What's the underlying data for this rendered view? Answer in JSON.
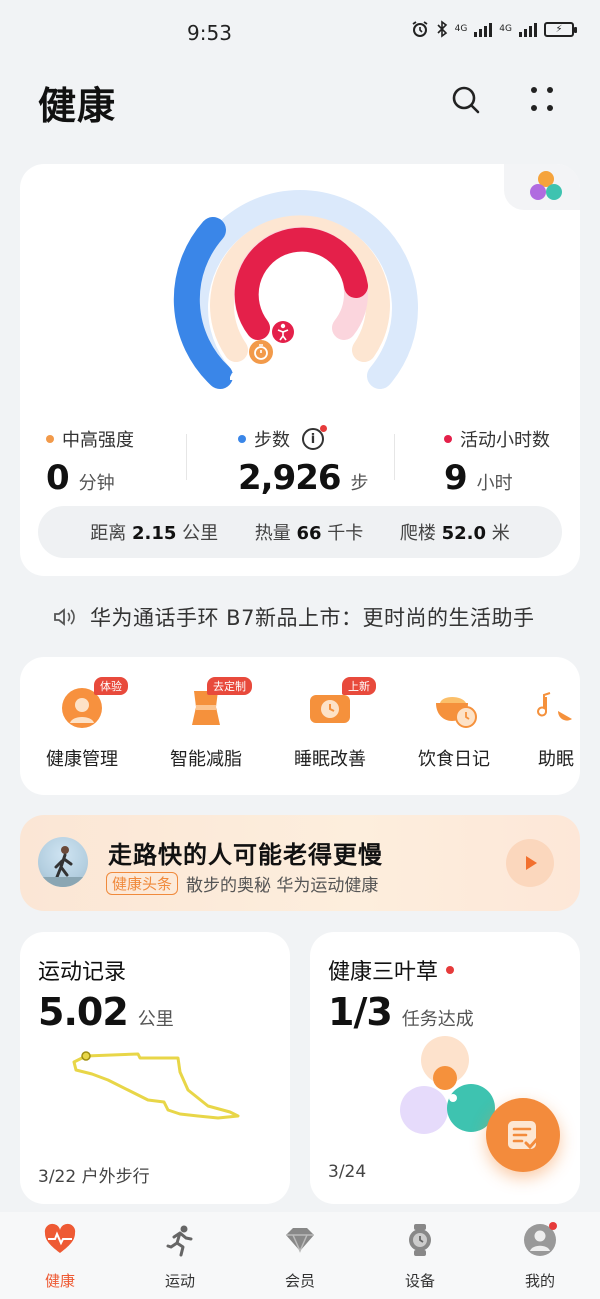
{
  "status_bar": {
    "time": "9:53",
    "network1": "4G",
    "network2": "4G"
  },
  "header": {
    "title": "健康"
  },
  "activity": {
    "rings": {
      "steps_progress": 0.58,
      "intensity_progress": 0.0,
      "active_hours_progress": 0.75
    },
    "intensity": {
      "label": "中高强度",
      "value": "0",
      "unit": "分钟",
      "color": "#f29a4a"
    },
    "steps": {
      "label": "步数",
      "value": "2,926",
      "unit": "步",
      "color": "#3a86e8"
    },
    "active_hours": {
      "label": "活动小时数",
      "value": "9",
      "unit": "小时",
      "color": "#e4204a"
    },
    "summary": {
      "distance_label": "距离",
      "distance_value": "2.15",
      "distance_unit": "公里",
      "calories_label": "热量",
      "calories_value": "66",
      "calories_unit": "千卡",
      "floors_label": "爬楼",
      "floors_value": "52.0",
      "floors_unit": "米"
    }
  },
  "news": {
    "text": "华为通话手环 B7新品上市：更时尚的生活助手"
  },
  "services": [
    {
      "label": "健康管理",
      "badge": "体验"
    },
    {
      "label": "智能减脂",
      "badge": "去定制"
    },
    {
      "label": "睡眠改善",
      "badge": "上新"
    },
    {
      "label": "饮食日记",
      "badge": ""
    },
    {
      "label": "助眠",
      "badge": ""
    }
  ],
  "banner": {
    "title": "走路快的人可能老得更慢",
    "tag": "健康头条",
    "subtitle": "散步的奥秘 华为运动健康"
  },
  "workout_card": {
    "title": "运动记录",
    "value": "5.02",
    "unit": "公里",
    "footer": "3/22 户外步行"
  },
  "clover_card": {
    "title": "健康三叶草",
    "value": "1/3",
    "unit": "任务达成",
    "footer": "3/24"
  },
  "tabbar": [
    {
      "label": "健康",
      "icon": "heart-pulse-icon",
      "active": true
    },
    {
      "label": "运动",
      "icon": "running-icon",
      "active": false
    },
    {
      "label": "会员",
      "icon": "diamond-icon",
      "active": false
    },
    {
      "label": "设备",
      "icon": "watch-icon",
      "active": false
    },
    {
      "label": "我的",
      "icon": "user-icon",
      "active": false
    }
  ],
  "colors": {
    "accent": "#ee5a34",
    "orange": "#f38b3c",
    "blue": "#3a86e8",
    "red": "#e4204a"
  }
}
